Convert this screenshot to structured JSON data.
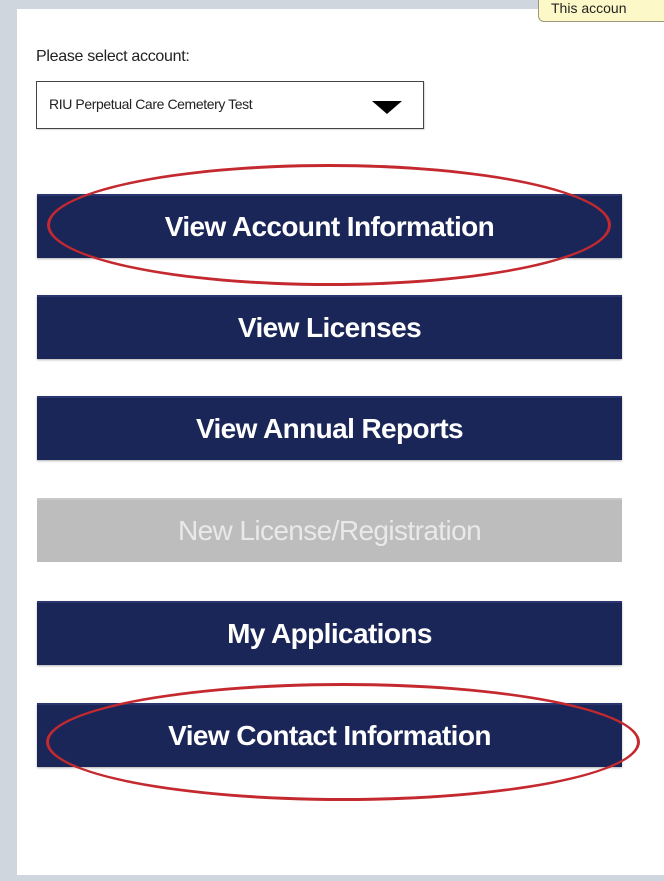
{
  "tooltip": {
    "text": "This accoun"
  },
  "account_selector": {
    "label": "Please select account:",
    "selected_value": "RIU Perpetual Care Cemetery Test"
  },
  "menu": {
    "buttons": [
      {
        "label": "View Account Information",
        "enabled": true,
        "highlighted": true
      },
      {
        "label": "View Licenses",
        "enabled": true,
        "highlighted": false
      },
      {
        "label": "View Annual Reports",
        "enabled": true,
        "highlighted": false
      },
      {
        "label": "New License/Registration",
        "enabled": false,
        "highlighted": false
      },
      {
        "label": "My Applications",
        "enabled": true,
        "highlighted": false
      },
      {
        "label": "View Contact Information",
        "enabled": true,
        "highlighted": true
      }
    ]
  },
  "colors": {
    "button_bg": "#1b2658",
    "button_disabled_bg": "#bdbdbd",
    "highlight_circle": "#c4292f"
  }
}
